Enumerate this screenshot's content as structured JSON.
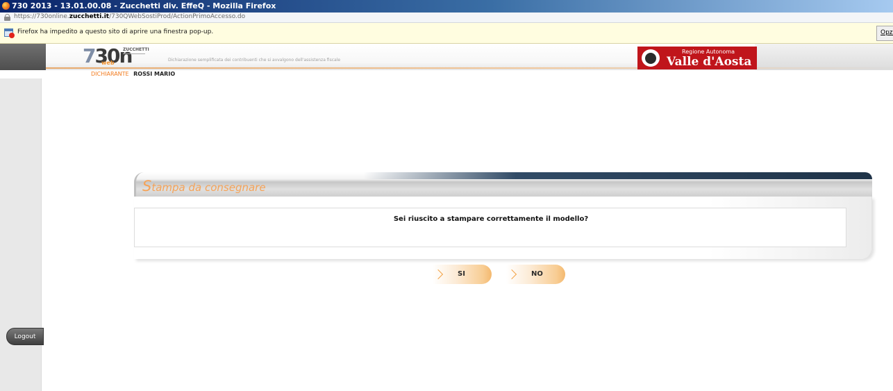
{
  "browser": {
    "window_title": "730 2013 - 13.01.00.08 - Zucchetti div. EffeQ - Mozilla Firefox",
    "url_prefix": "https://730online.",
    "url_domain": "zucchetti.it",
    "url_path": "/730QWebSostiProd/ActionPrimoAccesso.do",
    "popup_message": "Firefox ha impedito a questo sito di aprire una finestra pop-up.",
    "popup_options": "Opzioni"
  },
  "header": {
    "logo_number": "730n",
    "logo_seven": "7",
    "logo_rest": "30n",
    "logo_sub": "web",
    "brand": "ZUCCHETTI",
    "tagline": "Dichiarazione semplificata dei contribuenti che si avvalgono dell'assistenza fiscale",
    "region_sub": "Regione Autonoma",
    "region_name": "Vallée d'Aosta",
    "region_name_display": "Valle d'Aosta"
  },
  "declarant": {
    "label": "DICHIARANTE",
    "name": "ROSSI MARIO"
  },
  "sidebar": {
    "logout_label": "Logout"
  },
  "panel": {
    "title_first": "S",
    "title_rest": "tampa da consegnare",
    "question": "Sei riuscito a stampare correttamente il modello?",
    "yes_label": "SI",
    "no_label": "NO"
  },
  "colors": {
    "accent_orange": "#f27b1e",
    "title_orange": "#f5a358",
    "region_red": "#c0151b",
    "titlebar_blue": "#0a246a"
  }
}
